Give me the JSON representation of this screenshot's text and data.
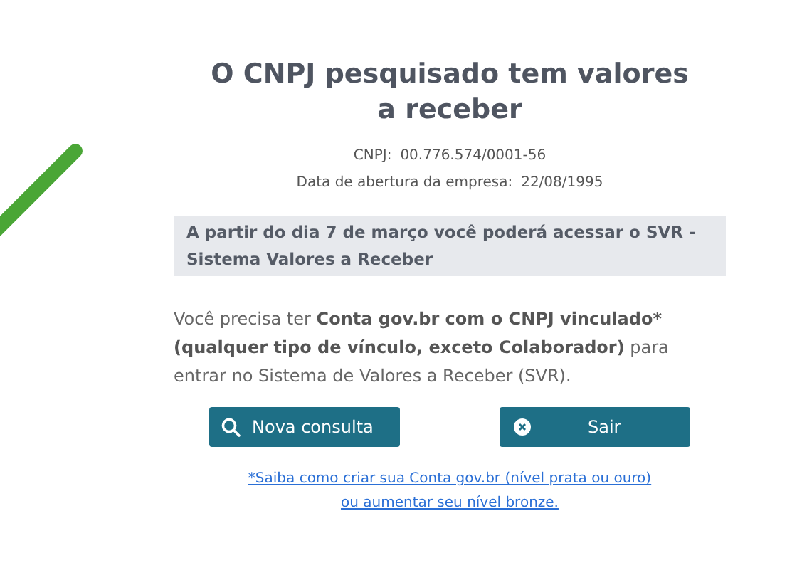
{
  "title": "O CNPJ pesquisado tem valores a receber",
  "cnpj": {
    "label": "CNPJ:",
    "value": "00.776.574/0001-56"
  },
  "opening_date": {
    "label": "Data de abertura da empresa:",
    "value": "22/08/1995"
  },
  "notice": "A partir do dia 7 de março você poderá acessar o SVR - Sistema Valores a Receber",
  "message": [
    {
      "text": "Você precisa ter ",
      "bold": false
    },
    {
      "text": "Conta gov.br com o CNPJ vinculado* (qualquer tipo de vínculo, exceto Colaborador)",
      "bold": true
    },
    {
      "text": " para entrar no Sistema de Valores a Receber (SVR).",
      "bold": false
    }
  ],
  "buttons": [
    {
      "kind": "search",
      "label": "Nova consulta"
    },
    {
      "kind": "exit",
      "label": "Sair"
    }
  ],
  "help_link": {
    "lines": [
      "*Saiba como criar sua Conta gov.br (nível prata ou ouro)",
      "ou aumentar seu nível bronze."
    ]
  }
}
